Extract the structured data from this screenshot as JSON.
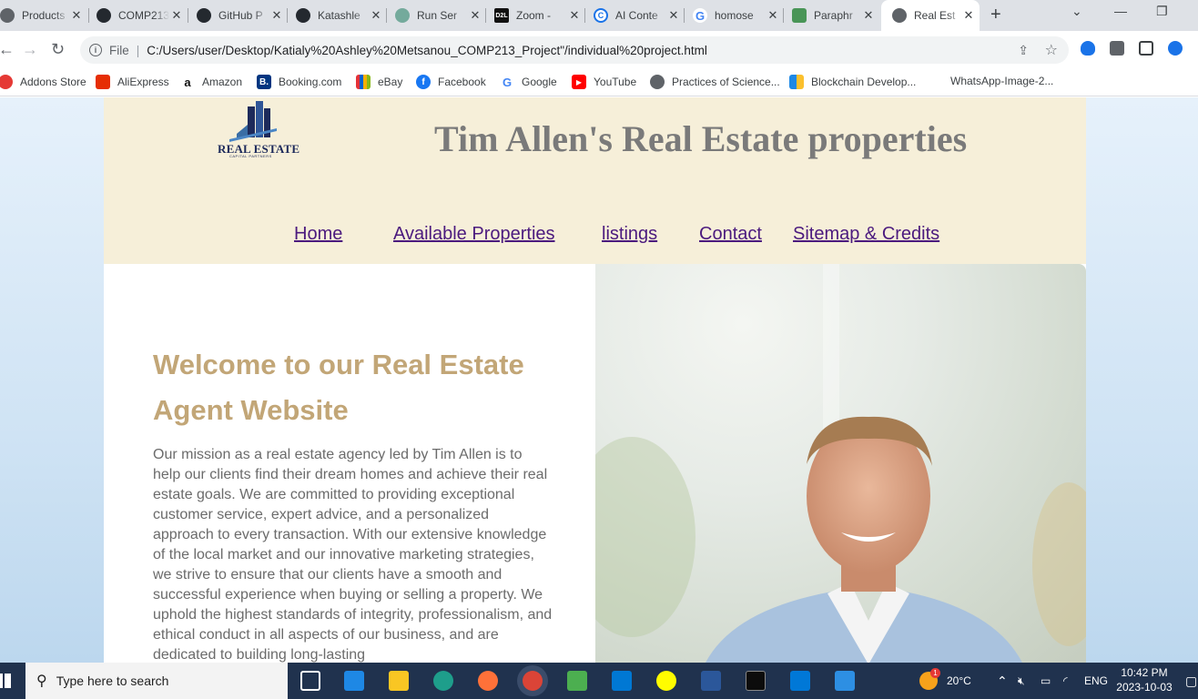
{
  "browser": {
    "tabs": [
      {
        "title": "Products",
        "icon": "globe-icon",
        "color": "#5f6368"
      },
      {
        "title": "COMP213",
        "icon": "github-icon",
        "color": "#24292f"
      },
      {
        "title": "GitHub P",
        "icon": "github-icon",
        "color": "#24292f"
      },
      {
        "title": "Katashle",
        "icon": "github-icon",
        "color": "#24292f"
      },
      {
        "title": "Run Ser",
        "icon": "openai-icon",
        "color": "#74aa9c"
      },
      {
        "title": "Zoom - ",
        "icon": "d2l-icon",
        "color": "#111111"
      },
      {
        "title": "AI Conte",
        "icon": "copyright-icon",
        "color": "#1a73e8"
      },
      {
        "title": "homose",
        "icon": "google-icon",
        "color": "#4285f4"
      },
      {
        "title": "Paraphr",
        "icon": "quillbot-icon",
        "color": "#499557"
      },
      {
        "title": "Real Est",
        "icon": "globe-icon",
        "color": "#5f6368"
      }
    ],
    "new_tab": "+",
    "file_label": "File",
    "url": "C:/Users/user/Desktop/Katialy%20Ashley%20Metsanou_COMP213_Project\"/individual%20project.html",
    "bookmarks": [
      {
        "label": "Addons Store",
        "icon": "addons-icon",
        "color": "#e53935"
      },
      {
        "label": "AliExpress",
        "icon": "aliexpress-icon",
        "color": "#e62e04"
      },
      {
        "label": "Amazon",
        "icon": "amazon-icon",
        "color": "#111111"
      },
      {
        "label": "Booking.com",
        "icon": "booking-icon",
        "color": "#003580"
      },
      {
        "label": "eBay",
        "icon": "ebay-icon",
        "color": "#e53238"
      },
      {
        "label": "Facebook",
        "icon": "facebook-icon",
        "color": "#1877f2"
      },
      {
        "label": "Google",
        "icon": "google-icon",
        "color": "#4285f4"
      },
      {
        "label": "YouTube",
        "icon": "youtube-icon",
        "color": "#ff0000"
      },
      {
        "label": "Practices of Science...",
        "icon": "globe-icon",
        "color": "#5f6368"
      },
      {
        "label": "Blockchain Develop...",
        "icon": "grid-icon",
        "color": "#1e88e5"
      },
      {
        "label": "WhatsApp-Image-2...",
        "icon": "",
        "color": ""
      }
    ]
  },
  "site": {
    "logo_text": "REAL ESTATE",
    "logo_sub": "CAPITAL PARTNERS",
    "title": "Tim Allen's Real Estate properties",
    "nav": [
      "Home",
      "Available Properties",
      "listings",
      "Contact",
      "Sitemap & Credits"
    ],
    "welcome": "Welcome to our Real Estate Agent Website",
    "mission": "Our mission as a real estate agency led by Tim Allen is to help our clients find their dream homes and achieve their real estate goals. We are committed to providing exceptional customer service, expert advice, and a personalized approach to every transaction. With our extensive knowledge of the local market and our innovative marketing strategies, we strive to ensure that our clients have a smooth and successful experience when buying or selling a property. We uphold the highest standards of integrity, professionalism, and ethical conduct in all aspects of our business, and are dedicated to building long-lasting"
  },
  "taskbar": {
    "search_placeholder": "Type here to search",
    "weather": "20°C",
    "language": "ENG",
    "time": "10:42 PM",
    "date": "2023-10-03",
    "notification_badge": "1"
  },
  "colors": {
    "header_bg": "#f6efd9",
    "title_color": "#7a7a7a",
    "nav_link": "#4b1a7e",
    "welcome_color": "#c2a677",
    "taskbar_bg": "#20324e"
  }
}
